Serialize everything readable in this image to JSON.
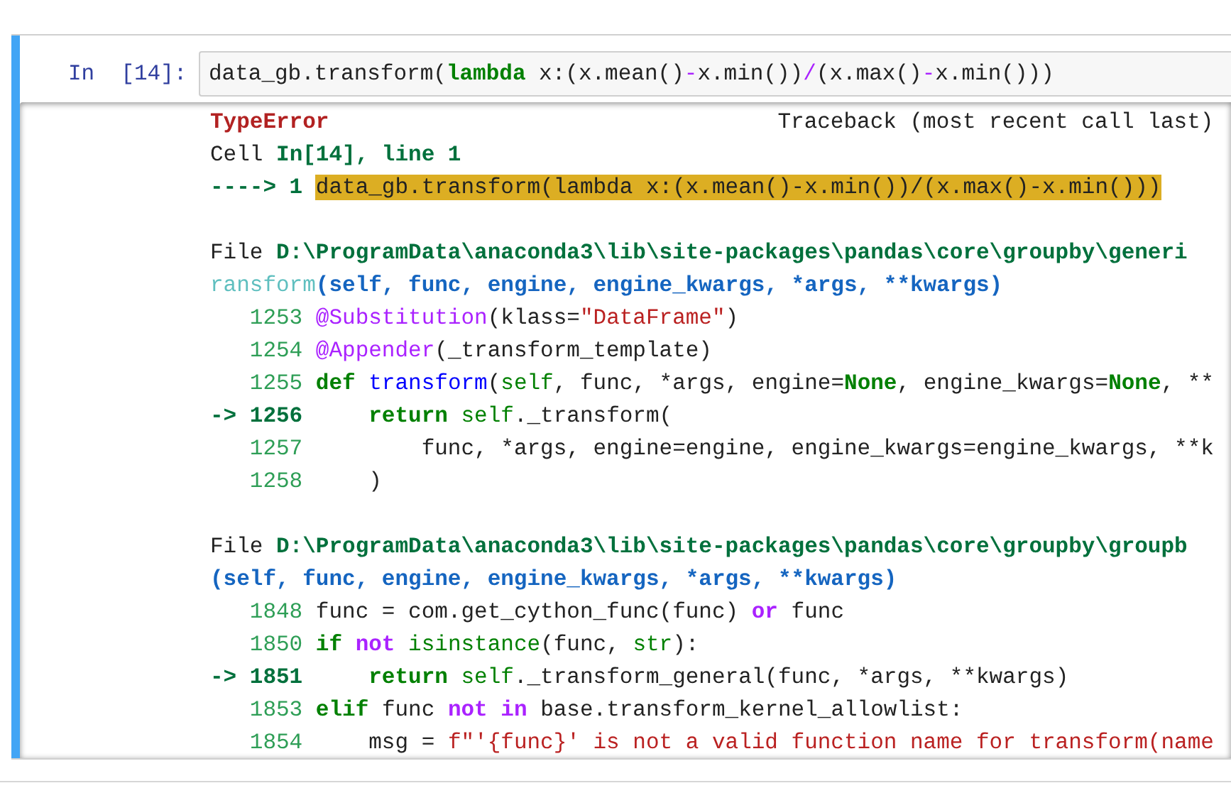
{
  "cell": {
    "prompt": "In  [14]:",
    "input": [
      {
        "text": "data_gb.transform(",
        "kind": "plain"
      },
      {
        "text": "lambda",
        "kind": "keyword"
      },
      {
        "text": " x:(x.mean()",
        "kind": "plain"
      },
      {
        "text": "-",
        "kind": "op"
      },
      {
        "text": "x.min())",
        "kind": "plain"
      },
      {
        "text": "/",
        "kind": "op"
      },
      {
        "text": "(x.max()",
        "kind": "plain"
      },
      {
        "text": "-",
        "kind": "op"
      },
      {
        "text": "x.min()))",
        "kind": "plain"
      }
    ],
    "output": [
      {
        "kind": "code",
        "segments": [
          {
            "text": "TypeError",
            "kind": "error"
          },
          {
            "text": "Traceback (most recent call last)",
            "kind": "aside"
          }
        ]
      },
      {
        "kind": "code",
        "segments": [
          {
            "text": "Cell ",
            "kind": "plain"
          },
          {
            "text": "In[14], line 1",
            "kind": "path"
          }
        ]
      },
      {
        "kind": "code",
        "segments": [
          {
            "text": "----> 1 ",
            "kind": "arrow"
          },
          {
            "text": "data_gb.transform(lambda x:(x.mean()-x.min())/(x.max()-x.min()))",
            "kind": "highlight"
          }
        ]
      },
      {
        "kind": "blank"
      },
      {
        "kind": "code",
        "segments": [
          {
            "text": "File ",
            "kind": "plain"
          },
          {
            "text": "D:\\ProgramData\\anaconda3\\lib\\site-packages\\pandas\\core\\groupby\\generi",
            "kind": "path"
          }
        ]
      },
      {
        "kind": "code",
        "segments": [
          {
            "text": "ransform",
            "kind": "funcname"
          },
          {
            "text": "(self, func, engine, engine_kwargs, *args, **kwargs)",
            "kind": "sig"
          }
        ]
      },
      {
        "kind": "code",
        "segments": [
          {
            "text": "   1253 ",
            "kind": "lineno"
          },
          {
            "text": "@Substitution",
            "kind": "deco"
          },
          {
            "text": "(klass=",
            "kind": "plain"
          },
          {
            "text": "\"DataFrame\"",
            "kind": "str"
          },
          {
            "text": ")",
            "kind": "plain"
          }
        ]
      },
      {
        "kind": "code",
        "segments": [
          {
            "text": "   1254 ",
            "kind": "lineno"
          },
          {
            "text": "@Appender",
            "kind": "deco"
          },
          {
            "text": "(_transform_template)",
            "kind": "plain"
          }
        ]
      },
      {
        "kind": "code",
        "segments": [
          {
            "text": "   1255 ",
            "kind": "lineno"
          },
          {
            "text": "def",
            "kind": "keyword"
          },
          {
            "text": " transform",
            "kind": "name"
          },
          {
            "text": "(",
            "kind": "plain"
          },
          {
            "text": "self",
            "kind": "builtin"
          },
          {
            "text": ", func, *args, engine=",
            "kind": "plain"
          },
          {
            "text": "None",
            "kind": "keyword"
          },
          {
            "text": ", engine_kwargs=",
            "kind": "plain"
          },
          {
            "text": "None",
            "kind": "keyword"
          },
          {
            "text": ", **",
            "kind": "plain"
          }
        ]
      },
      {
        "kind": "code",
        "segments": [
          {
            "text": "-> 1256 ",
            "kind": "current"
          },
          {
            "text": "    return",
            "kind": "keyword"
          },
          {
            "text": " self",
            "kind": "builtin"
          },
          {
            "text": "._transform(",
            "kind": "plain"
          }
        ]
      },
      {
        "kind": "code",
        "segments": [
          {
            "text": "   1257 ",
            "kind": "lineno"
          },
          {
            "text": "        func, *args, engine=engine, engine_kwargs=engine_kwargs, **k",
            "kind": "plain"
          }
        ]
      },
      {
        "kind": "code",
        "segments": [
          {
            "text": "   1258 ",
            "kind": "lineno"
          },
          {
            "text": "    )",
            "kind": "plain"
          }
        ]
      },
      {
        "kind": "blank"
      },
      {
        "kind": "code",
        "segments": [
          {
            "text": "File ",
            "kind": "plain"
          },
          {
            "text": "D:\\ProgramData\\anaconda3\\lib\\site-packages\\pandas\\core\\groupby\\groupb",
            "kind": "path"
          }
        ]
      },
      {
        "kind": "code",
        "segments": [
          {
            "text": "(self, func, engine, engine_kwargs, *args, **kwargs)",
            "kind": "sig"
          }
        ]
      },
      {
        "kind": "code",
        "segments": [
          {
            "text": "   1848 ",
            "kind": "lineno"
          },
          {
            "text": "func = com.get_cython_func(func) ",
            "kind": "plain"
          },
          {
            "text": "or",
            "kind": "opword"
          },
          {
            "text": " func",
            "kind": "plain"
          }
        ]
      },
      {
        "kind": "code",
        "segments": [
          {
            "text": "   1850 ",
            "kind": "lineno"
          },
          {
            "text": "if",
            "kind": "keyword"
          },
          {
            "text": " not",
            "kind": "opword"
          },
          {
            "text": " isinstance",
            "kind": "builtin"
          },
          {
            "text": "(func, ",
            "kind": "plain"
          },
          {
            "text": "str",
            "kind": "builtin"
          },
          {
            "text": "):",
            "kind": "plain"
          }
        ]
      },
      {
        "kind": "code",
        "segments": [
          {
            "text": "-> 1851 ",
            "kind": "current"
          },
          {
            "text": "    return",
            "kind": "keyword"
          },
          {
            "text": " self",
            "kind": "builtin"
          },
          {
            "text": "._transform_general(func, *args, **kwargs)",
            "kind": "plain"
          }
        ]
      },
      {
        "kind": "code",
        "segments": [
          {
            "text": "   1853 ",
            "kind": "lineno"
          },
          {
            "text": "elif",
            "kind": "keyword"
          },
          {
            "text": " func ",
            "kind": "plain"
          },
          {
            "text": "not in",
            "kind": "opword"
          },
          {
            "text": " base.transform_kernel_allowlist:",
            "kind": "plain"
          }
        ]
      },
      {
        "kind": "code",
        "segments": [
          {
            "text": "   1854 ",
            "kind": "lineno"
          },
          {
            "text": "    msg = ",
            "kind": "plain"
          },
          {
            "text": "f\"'{func}' is not a valid function name for transform(name",
            "kind": "str"
          }
        ]
      }
    ]
  }
}
